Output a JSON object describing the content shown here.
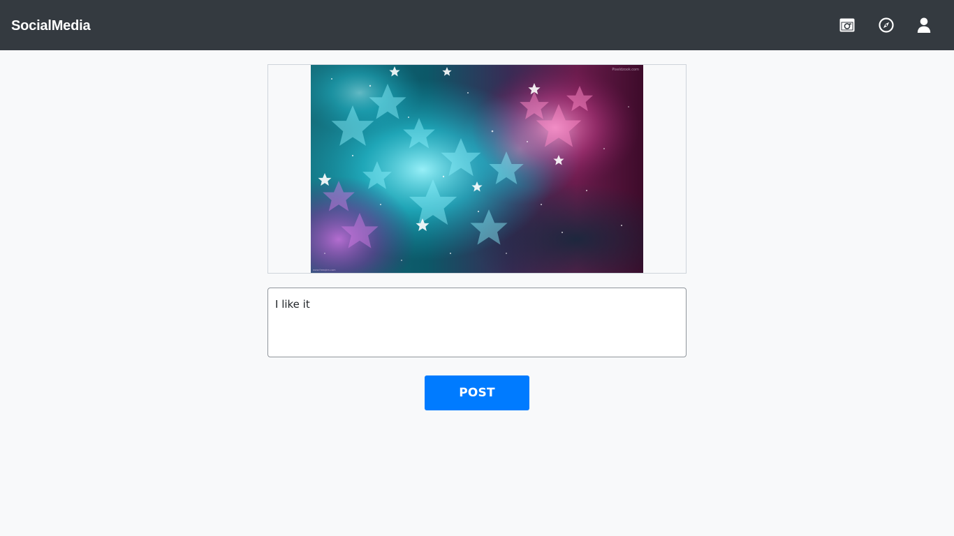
{
  "navbar": {
    "brand": "SocialMedia",
    "icons": [
      {
        "name": "camera-icon"
      },
      {
        "name": "compass-icon"
      },
      {
        "name": "user-icon"
      }
    ],
    "background_color": "#343a40"
  },
  "image_preview": {
    "corner_text": "Pixeldzook.com",
    "watermark_text": "www.freeqkm.com"
  },
  "caption": {
    "value": "I like it"
  },
  "post_button": {
    "label": "POST",
    "color": "#007bff"
  }
}
